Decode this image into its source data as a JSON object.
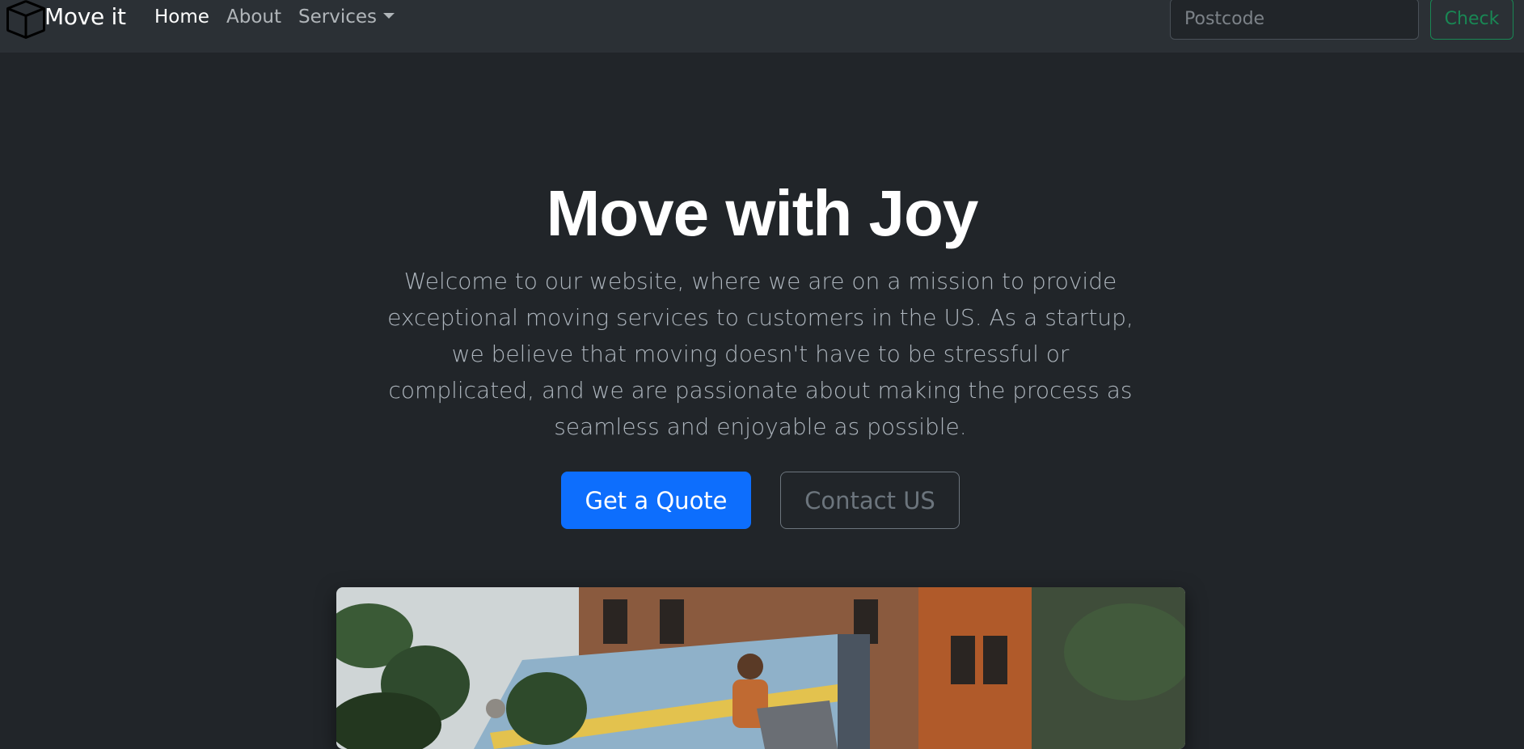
{
  "navbar": {
    "brand_icon": "box-icon",
    "brand_name": "Move it",
    "links": [
      {
        "label": "Home",
        "active": true
      },
      {
        "label": "About",
        "active": false
      }
    ],
    "services_label": "Services",
    "postcode_placeholder": "Postcode",
    "check_label": "Check"
  },
  "hero": {
    "title": "Move with Joy",
    "lead": "Welcome to our website, where we are on a mission to provide exceptional moving services to customers in the US. As a startup, we believe that moving doesn't have to be stressful or complicated, and we are passionate about making the process as seamless and enjoyable as possible.",
    "primary_button": "Get a Quote",
    "secondary_button": "Contact US"
  },
  "colors": {
    "background": "#212529",
    "navbar": "#2b3035",
    "primary": "#0d6efd",
    "success": "#198754",
    "secondary": "#6c757d"
  }
}
